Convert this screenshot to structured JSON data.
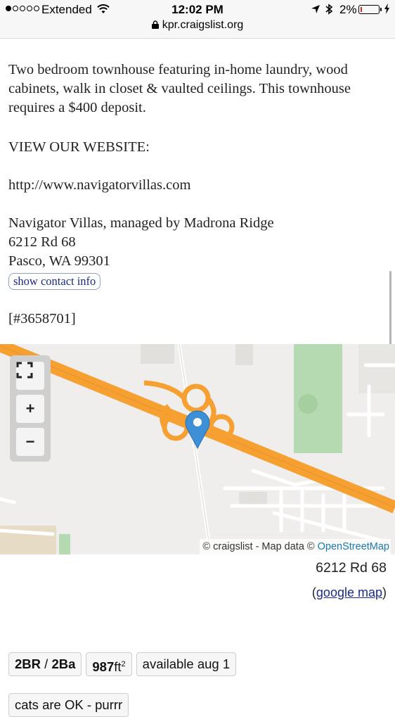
{
  "status_bar": {
    "carrier": "Extended",
    "time": "12:02 PM",
    "battery_percent": "2%",
    "url": "kpr.craigslist.org",
    "signal_bars_filled": 1,
    "signal_bars_total": 5,
    "battery_level": 0.02
  },
  "listing": {
    "description": "Two bedroom townhouse featuring in-home laundry, wood cabinets, walk in closet & vaulted ceilings. This townhouse requires a $400 deposit.",
    "view_website": "VIEW OUR WEBSITE:",
    "website_url": "http://www.navigatorvillas.com",
    "address_line1": "Navigator Villas, managed by Madrona Ridge",
    "address_line2": "6212 Rd 68",
    "address_line3": "Pasco, WA 99301",
    "contact_button": "show contact info",
    "listing_id": "[#3658701]"
  },
  "map": {
    "zoom_in": "+",
    "zoom_out": "−",
    "attribution_prefix": "© craigslist - Map data © ",
    "attribution_link": "OpenStreetMap",
    "address": "6212 Rd 68",
    "google_map_link": "google map",
    "google_map_open": "(",
    "google_map_close": ")"
  },
  "attributes": {
    "bedrooms": "2BR",
    "separator": " / ",
    "bathrooms": "2Ba",
    "area_value": "987",
    "area_unit": "ft",
    "area_exp": "2",
    "availability": "available aug 1",
    "pets": "cats are OK - purrr"
  },
  "colors": {
    "highway": "#f5a031",
    "park": "#b5d9b0",
    "marker": "#3d8fd6",
    "link": "#1a2a8a"
  }
}
